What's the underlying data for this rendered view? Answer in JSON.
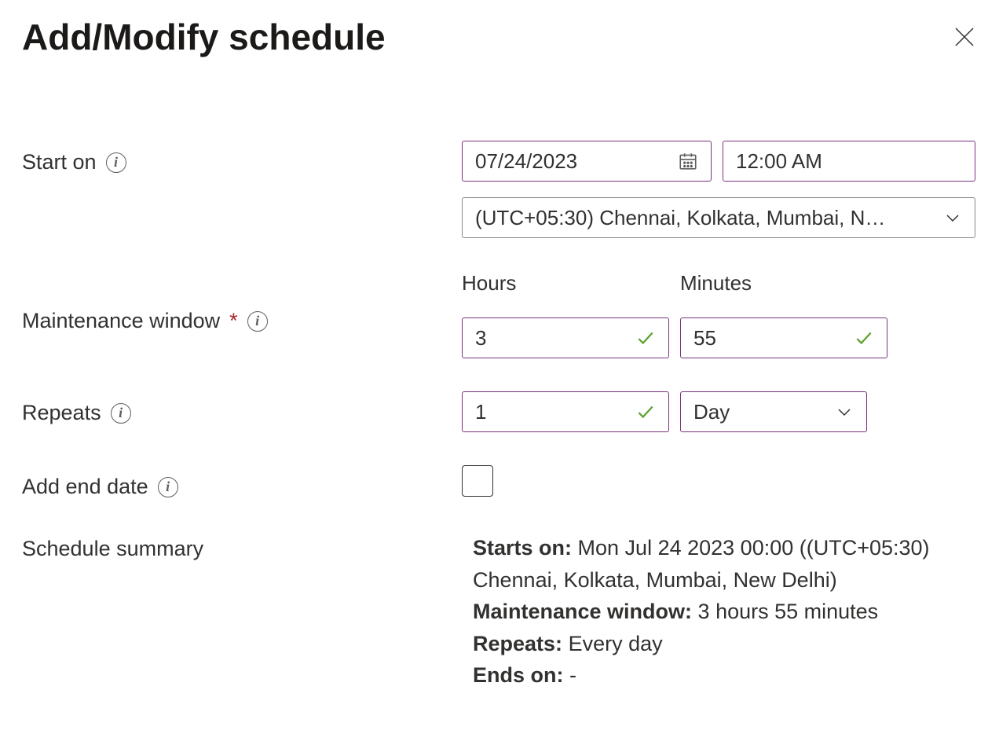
{
  "title": "Add/Modify schedule",
  "labels": {
    "start_on": "Start on",
    "maintenance_window": "Maintenance window",
    "repeats": "Repeats",
    "add_end_date": "Add end date",
    "schedule_summary": "Schedule summary",
    "hours": "Hours",
    "minutes": "Minutes"
  },
  "start": {
    "date": "07/24/2023",
    "time": "12:00 AM",
    "timezone": "(UTC+05:30) Chennai, Kolkata, Mumbai, N…"
  },
  "window": {
    "hours": "3",
    "minutes": "55"
  },
  "repeats": {
    "count": "1",
    "unit": "Day"
  },
  "add_end_date_checked": false,
  "summary": {
    "starts_label": "Starts on:",
    "starts_value": "Mon Jul 24 2023 00:00 ((UTC+05:30) Chennai, Kolkata, Mumbai, New Delhi)",
    "mw_label": "Maintenance window:",
    "mw_value": "3 hours 55 minutes",
    "repeats_label": "Repeats:",
    "repeats_value": "Every day",
    "ends_label": "Ends on:",
    "ends_value": "-"
  }
}
